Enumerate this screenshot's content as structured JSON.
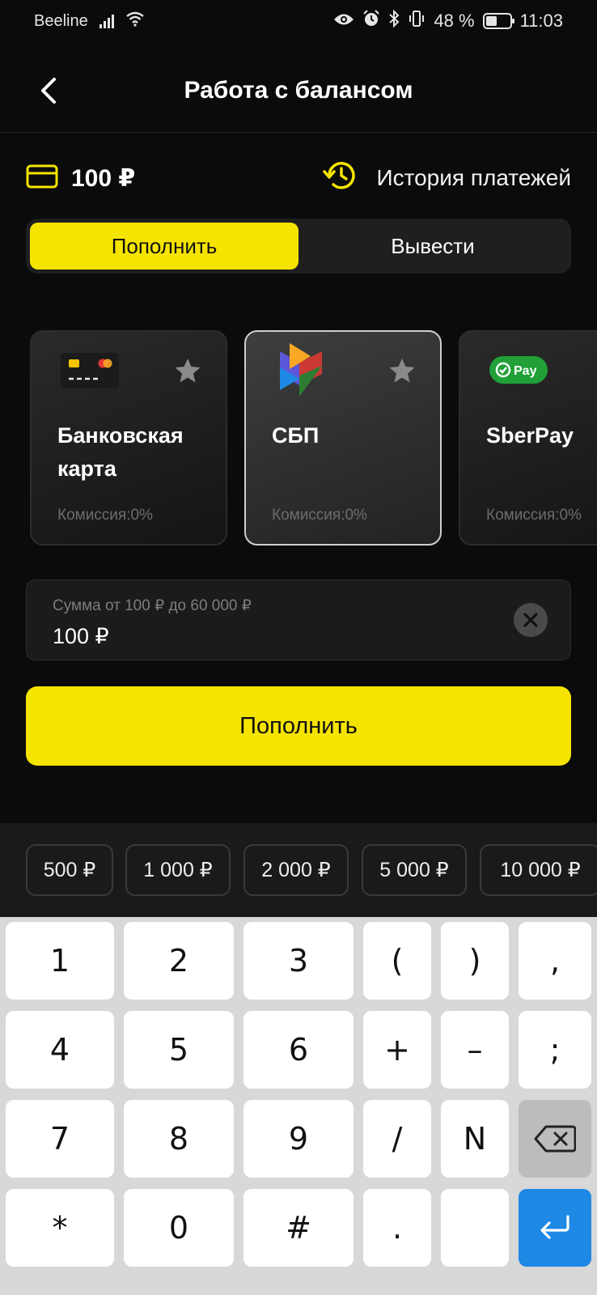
{
  "status_bar": {
    "carrier": "Beeline",
    "battery_percent": "48 %",
    "battery_level": 0.48,
    "time": "11:03"
  },
  "header": {
    "title": "Работа с балансом"
  },
  "balance": {
    "amount": "100 ₽",
    "history_label": "История платежей"
  },
  "tabs": [
    {
      "label": "Пополнить",
      "active": true
    },
    {
      "label": "Вывести",
      "active": false
    }
  ],
  "methods": [
    {
      "name": "Банковская карта",
      "fee": "Комиссия:0%",
      "selected": false,
      "icon": "bank-card-icon"
    },
    {
      "name": "СБП",
      "fee": "Комиссия:0%",
      "selected": true,
      "icon": "sbp-logo-icon"
    },
    {
      "name": "SberPay",
      "fee": "Комиссия:0%",
      "selected": false,
      "icon": "sberpay-logo-icon",
      "logo_text": "Pay"
    }
  ],
  "amount_input": {
    "placeholder": "Сумма от 100 ₽ до 60 000 ₽",
    "value": "100 ₽"
  },
  "submit_label": "Пополнить",
  "quick_amounts": [
    "500 ₽",
    "1 000 ₽",
    "2 000 ₽",
    "5 000 ₽",
    "10 000 ₽"
  ],
  "keyboard": {
    "rows": [
      [
        "1",
        "2",
        "3",
        "(",
        ")",
        ","
      ],
      [
        "4",
        "5",
        "6",
        "+",
        "–",
        ";"
      ],
      [
        "7",
        "8",
        "9",
        "/",
        "N",
        ""
      ],
      [
        "*",
        "0",
        "#",
        ".",
        "",
        ""
      ]
    ],
    "special_keys": {
      "backspace": "backspace-icon",
      "enter": "enter-icon",
      "space": "space-key"
    }
  },
  "colors": {
    "accent": "#f5e400",
    "background": "#0b0b0b",
    "enter_key": "#1e88e5"
  }
}
